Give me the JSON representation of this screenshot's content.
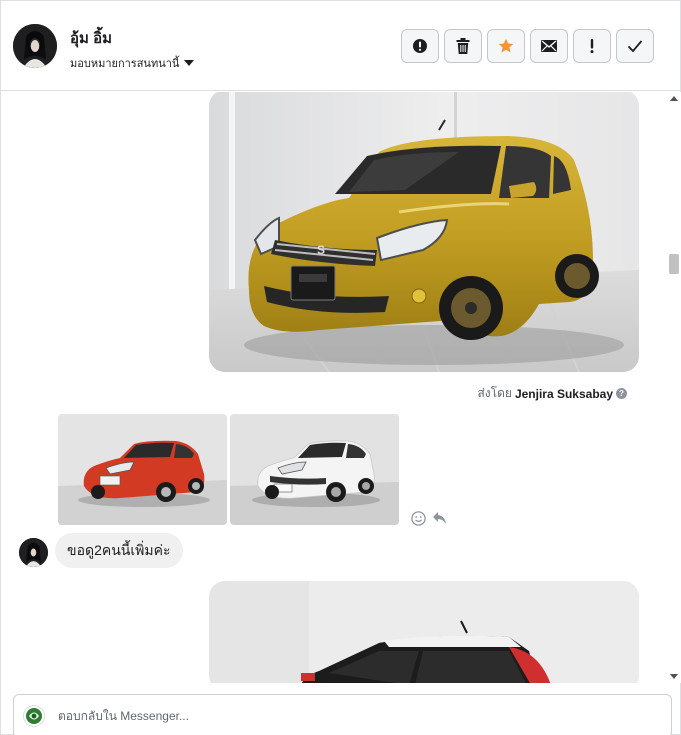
{
  "header": {
    "contact_name": "อุ้ม อิ้ม",
    "assign_label": "มอบหมายการสนทนานี้",
    "toolbar": [
      {
        "name": "report-spam-button",
        "icon": "alert-circle-icon"
      },
      {
        "name": "delete-button",
        "icon": "trash-icon"
      },
      {
        "name": "star-button",
        "icon": "star-icon",
        "color": "#f7923b"
      },
      {
        "name": "mark-unread-button",
        "icon": "envelope-icon"
      },
      {
        "name": "follow-up-button",
        "icon": "exclamation-icon"
      },
      {
        "name": "mark-done-button",
        "icon": "checkmark-icon"
      }
    ]
  },
  "chat": {
    "sent_by_prefix": "ส่งโดย",
    "sent_by_name": "Jenjira Suksabay",
    "customer_message": "ขอดู2คนนี้เพิ่มค่ะ"
  },
  "composer": {
    "placeholder": "ตอบกลับใน Messenger..."
  },
  "colors": {
    "accent_star": "#f7923b",
    "bubble_bg": "#f1f0f0",
    "car_yellow": "#c9a42a",
    "car_red": "#d23a23",
    "car_white": "#f4f4f4"
  }
}
